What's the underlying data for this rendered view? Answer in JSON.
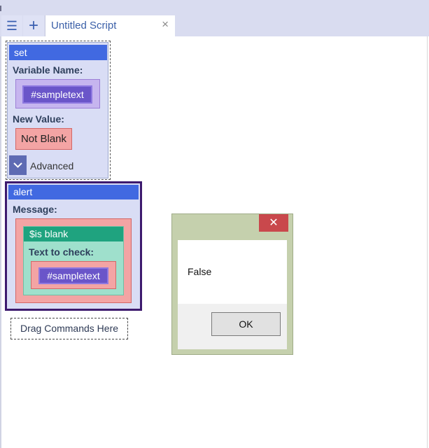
{
  "toolbar": {
    "menu_icon": "☰",
    "add_icon": "+"
  },
  "tab": {
    "title": "Untitled Script",
    "close": "×"
  },
  "set_block": {
    "header": "set",
    "variable_label": "Variable Name:",
    "variable_value": "#sampletext",
    "new_value_label": "New Value:",
    "new_value": "Not Blank",
    "advanced_label": "Advanced"
  },
  "alert_block": {
    "header": "alert",
    "message_label": "Message:",
    "function_header": "$is blank",
    "text_to_check_label": "Text to check:",
    "text_to_check_value": "#sampletext"
  },
  "drop_zone": {
    "label": "Drag Commands Here"
  },
  "dialog": {
    "close": "✕",
    "message": "False",
    "ok_label": "OK"
  },
  "colors": {
    "command_header": "#4169e1",
    "function_header": "#1fa37f",
    "variable": "#6a55c9",
    "value": "#f3a4a4",
    "dialog_frame": "#c5d0ad",
    "close_button": "#c9484c"
  }
}
